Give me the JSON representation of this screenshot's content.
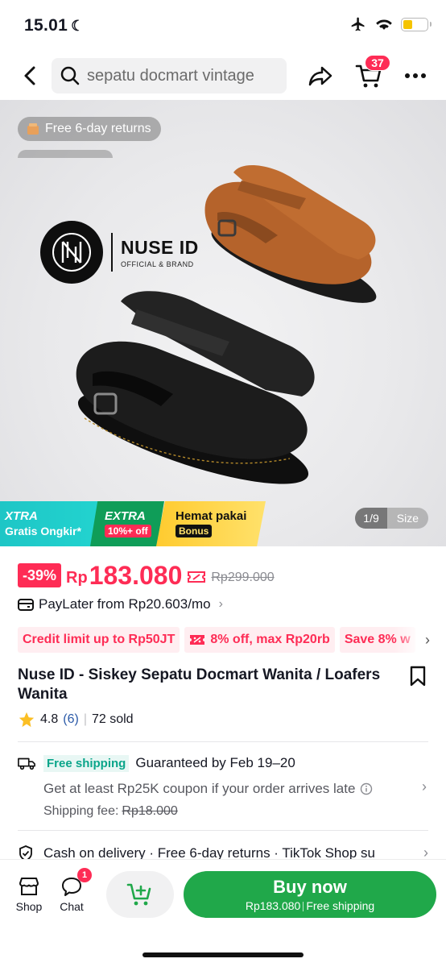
{
  "status_bar": {
    "time": "15.01",
    "moon": "☾"
  },
  "header": {
    "search_query": "sepatu docmart vintage",
    "cart_count": "37"
  },
  "gallery": {
    "return_chip": "Free 6-day returns",
    "brand_name": "NUSE ID",
    "brand_sub": "OFFICIAL & BRAND",
    "promo_xtra_title": "XTRA",
    "promo_xtra_sub": "Gratis Ongkir*",
    "promo_extra_title": "EXTRA",
    "promo_extra_sub": "10%+ off",
    "promo_hemat_title": "Hemat pakai",
    "promo_hemat_sub": "Bonus",
    "image_counter": "1/9",
    "size_label": "Size"
  },
  "price": {
    "discount": "-39%",
    "currency": "Rp",
    "current": "183.080",
    "original": "Rp299.000"
  },
  "paylater": {
    "text": "PayLater from Rp20.603/mo"
  },
  "offers": [
    "Credit limit up to Rp50JT",
    "8% off, max Rp20rb",
    "Save 8% w"
  ],
  "product": {
    "title": "Nuse ID - Siskey Sepatu Docmart Wanita / Loafers Wanita",
    "rating": "4.8",
    "review_count": "(6)",
    "sold": "72 sold"
  },
  "shipping": {
    "badge": "Free shipping",
    "guarantee": "Guaranteed by Feb 19–20",
    "coupon_note": "Get at least Rp25K coupon if your order arrives late",
    "fee_label": "Shipping fee:",
    "fee_value": "Rp18.000"
  },
  "services": {
    "text": "Cash on delivery · Free 6-day returns · TikTok Shop su"
  },
  "bottom_bar": {
    "shop_label": "Shop",
    "chat_label": "Chat",
    "chat_badge": "1",
    "buy_now_label": "Buy now",
    "buy_now_price": "Rp183.080",
    "buy_now_shipping": "Free shipping"
  },
  "colors": {
    "accent": "#fe2c55",
    "buy_now": "#20a84a",
    "battery": "#f5c400"
  }
}
